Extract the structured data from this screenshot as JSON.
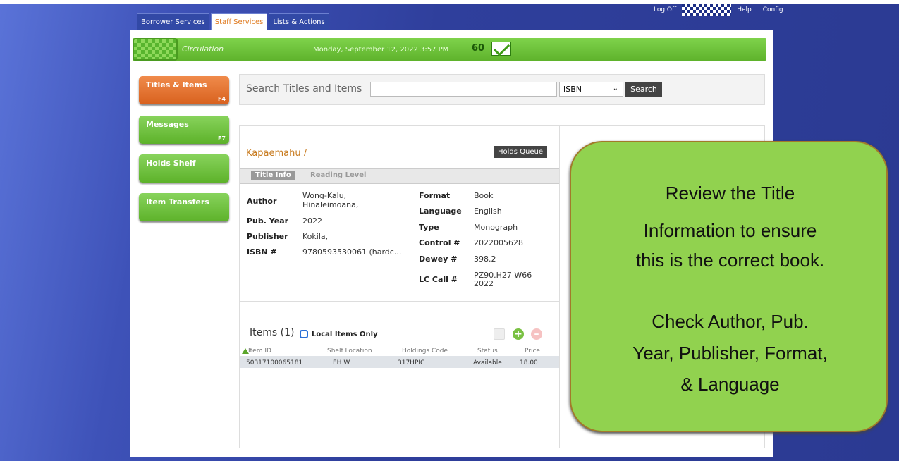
{
  "tabs": [
    {
      "label": "Borrower Services"
    },
    {
      "label": "Staff Services"
    },
    {
      "label": "Lists & Actions"
    }
  ],
  "toplinks": {
    "logoff": "Log Off",
    "help": "Help",
    "config": "Config"
  },
  "header": {
    "module": "Circulation",
    "datetime": "Monday, September 12, 2022 3:57 PM",
    "message_count": "60"
  },
  "sidebar": {
    "items": [
      {
        "label": "Titles & Items",
        "key": "F4"
      },
      {
        "label": "Messages",
        "key": "F7"
      },
      {
        "label": "Holds Shelf"
      },
      {
        "label": "Item Transfers"
      }
    ]
  },
  "search": {
    "label": "Search Titles and Items",
    "value": "",
    "type": "ISBN",
    "button": "Search"
  },
  "title": {
    "name": "Kapaemahu /",
    "holds_queue_btn": "Holds Queue",
    "tabs": [
      "Title Info",
      "Reading Level"
    ],
    "left": [
      {
        "k": "Author",
        "v1": "Wong-Kalu,",
        "v2": "Hinaleimoana,"
      },
      {
        "k": "Pub. Year",
        "v": "2022"
      },
      {
        "k": "Publisher",
        "v": "Kokila,"
      },
      {
        "k": "ISBN #",
        "v": "9780593530061 (hardc..."
      }
    ],
    "right": [
      {
        "k": "Format",
        "v": "Book"
      },
      {
        "k": "Language",
        "v": "English"
      },
      {
        "k": "Type",
        "v": "Monograph"
      },
      {
        "k": "Control #",
        "v": "2022005628"
      },
      {
        "k": "Dewey #",
        "v": "398.2"
      },
      {
        "k": "LC Call #",
        "v1": "PZ90.H27 W66",
        "v2": "2022"
      }
    ]
  },
  "items": {
    "title": "Items (1)",
    "local_only": "Local Items Only",
    "columns": [
      "Item ID",
      "Shelf Location",
      "Holdings Code",
      "Status",
      "Price"
    ],
    "rows": [
      {
        "id": "50317100065181",
        "shelf": "EH W",
        "holdings": "317HPIC",
        "status": "Available",
        "price": "18.00"
      }
    ]
  },
  "callout": {
    "lines": [
      "Review the Title",
      "Information to ensure",
      "this is the correct book.",
      "",
      "Check Author, Pub.",
      "Year, Publisher, Format,",
      "& Language"
    ]
  }
}
